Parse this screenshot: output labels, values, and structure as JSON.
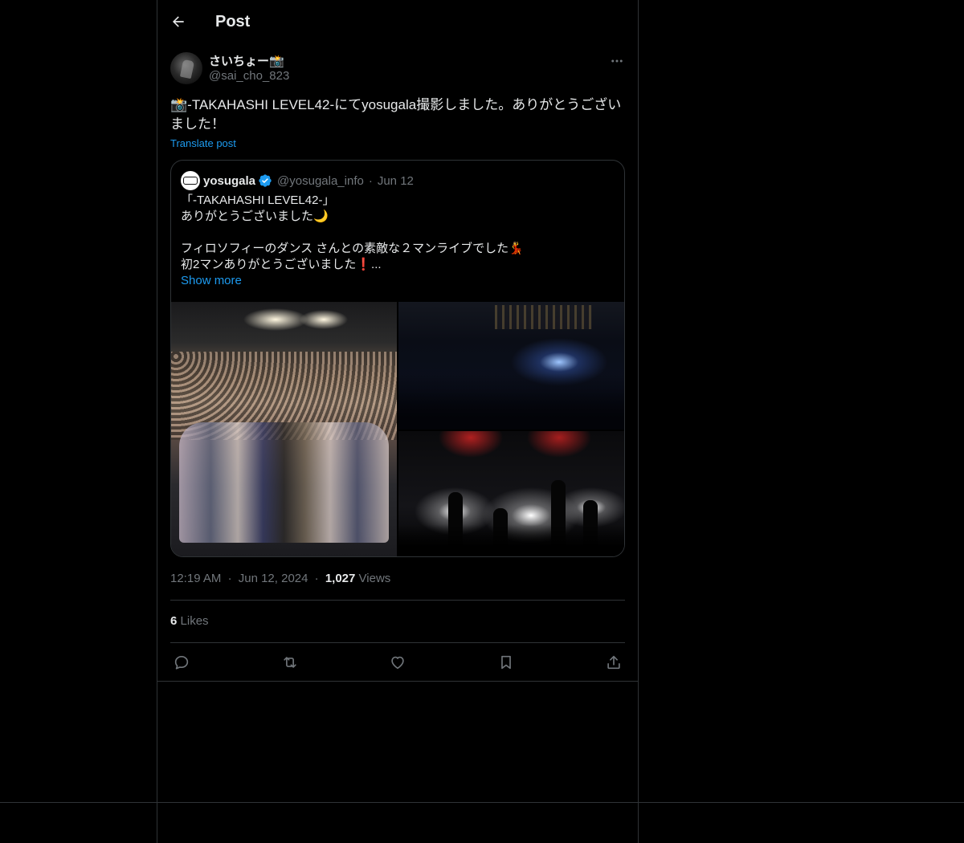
{
  "header": {
    "title": "Post",
    "back_icon": "arrow-left-icon"
  },
  "author": {
    "name": "さいちょー📸",
    "handle": "@sai_cho_823",
    "more_icon": "more-horizontal-icon"
  },
  "post": {
    "text": "📸-TAKAHASHI LEVEL42-にてyosugala撮影しました。ありがとうございました！",
    "translate_label": "Translate post"
  },
  "quote": {
    "name": "yosugala",
    "verified_icon": "verified-badge-icon",
    "handle": "@yosugala_info",
    "separator": "·",
    "date": "Jun 12",
    "text": "「-TAKAHASHI LEVEL42-」\nありがとうございました🌙\n\nフィロソフィーのダンス さんとの素敵な２マンライブでした💃\n初2マンありがとうございました❗️...",
    "show_more": "Show more"
  },
  "meta": {
    "time": "12:19 AM",
    "dot1": "·",
    "date": "Jun 12, 2024",
    "dot2": "·",
    "views_count": "1,027",
    "views_label": "Views"
  },
  "stats": {
    "likes_count": "6",
    "likes_label": "Likes"
  },
  "actions": {
    "reply_icon": "reply-icon",
    "repost_icon": "repost-icon",
    "like_icon": "heart-icon",
    "bookmark_icon": "bookmark-icon",
    "share_icon": "share-icon"
  },
  "colors": {
    "background": "#000000",
    "border": "#2f3336",
    "text": "#e7e9ea",
    "secondary": "#71767b",
    "accent": "#1d9bf0"
  }
}
